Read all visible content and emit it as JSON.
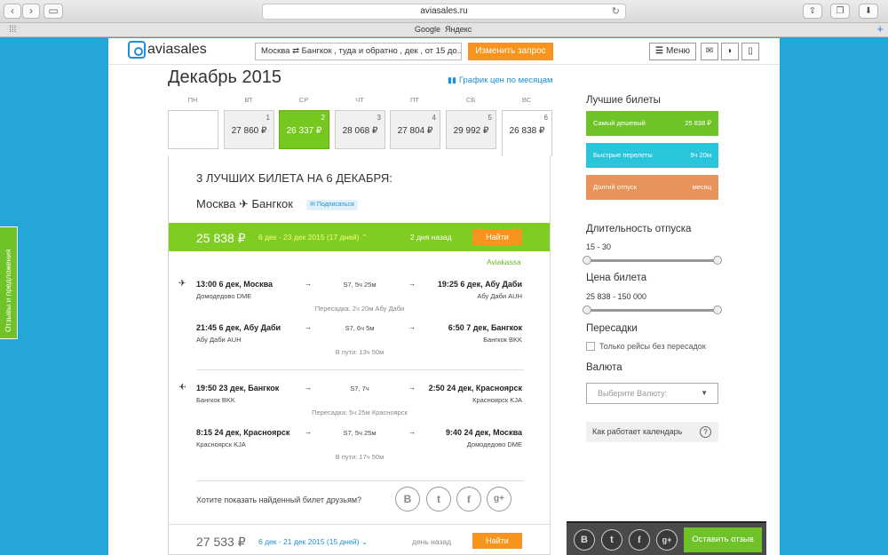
{
  "browser": {
    "url": "aviasales.ru",
    "reload_glyph": "↻",
    "back_glyph": "‹",
    "forward_glyph": "›",
    "bookmarks": [
      "Google",
      "Яндекс"
    ]
  },
  "header": {
    "logo": "aviasales",
    "search_summary": "Москва ⇄ Бангкок , туда и обратно , дек , от 15 до...",
    "change_label": "Изменить запрос",
    "menu_label": "Меню"
  },
  "calendar": {
    "title": "Декабрь 2015",
    "price_chart_link": "График цен по месяцам",
    "weekdays": [
      "ПН",
      "ВТ",
      "СР",
      "ЧТ",
      "ПТ",
      "СБ",
      "ВС"
    ],
    "days": [
      {
        "num": "",
        "price": ""
      },
      {
        "num": "1",
        "price": "27 860 ₽"
      },
      {
        "num": "2",
        "price": "26 337 ₽"
      },
      {
        "num": "3",
        "price": "28 068 ₽"
      },
      {
        "num": "4",
        "price": "27 804 ₽"
      },
      {
        "num": "5",
        "price": "29 992 ₽"
      },
      {
        "num": "6",
        "price": "26 838 ₽"
      }
    ]
  },
  "results": {
    "heading": "3 ЛУЧШИХ БИЛЕТА НА 6 ДЕКАБРЯ:",
    "route": "Москва ✈ Бангкок",
    "subscribe": "Подписаться",
    "offer1": {
      "price": "25 838 ₽",
      "dates": "6 дек - 23 дек 2015 (17 дней)",
      "ago": "2 дня назад",
      "buy": "Найти",
      "agency": "Aviakassa",
      "legs": [
        {
          "dep": "13:00 6 дек, Москва",
          "dep_ap": "Домодедово DME",
          "dur": "S7, 5ч 25м",
          "arr": "19:25 6 дек, Абу Даби",
          "arr_ap": "Абу Даби AUH"
        },
        {
          "dep": "21:45 6 дек, Абу Даби",
          "dep_ap": "Абу Даби AUH",
          "dur": "S7, 6ч 5м",
          "arr": "6:50 7 дек, Бангкок",
          "arr_ap": "Бангкок BKK"
        },
        {
          "dep": "19:50 23 дек, Бангкок",
          "dep_ap": "Бангкок BKK",
          "dur": "S7, 7ч",
          "arr": "2:50 24 дек, Красноярск",
          "arr_ap": "Красноярск KJA"
        },
        {
          "dep": "8:15 24 дек, Красноярск",
          "dep_ap": "Красноярск KJA",
          "dur": "S7, 5ч 25м",
          "arr": "9:40 24 дек, Москва",
          "arr_ap": "Домодедово DME"
        }
      ],
      "notes": [
        "Пересадка: 2ч 20м Абу Даби",
        "В пути: 13ч 50м",
        "Пересадка: 5ч 25м Красноярск",
        "В пути: 17ч 50м"
      ]
    },
    "share_text": "Хотите показать найденный билет друзьям?",
    "offer2": {
      "price": "27 533 ₽",
      "dates": "6 дек - 21 дек 2015 (15 дней)",
      "ago": "день назад",
      "buy": "Найти"
    }
  },
  "sidebar": {
    "best_title": "Лучшие билеты",
    "best": [
      {
        "label": "Самый дешевый",
        "value": "25 838 ₽",
        "color": "#6fc329"
      },
      {
        "label": "Быстрые перелеты",
        "value": "9ч 20м",
        "color": "#29c6db"
      },
      {
        "label": "Долгий отпуск",
        "value": "месяц",
        "color": "#e8935a"
      }
    ],
    "duration_title": "Длительность отпуска",
    "duration_range": "15 - 30",
    "price_title": "Цена билета",
    "price_range": "25 838 - 150 000",
    "transfers_title": "Пересадки",
    "transfers_checkbox": "Только рейсы без пересадок",
    "currency_title": "Валюта",
    "currency_placeholder": "Выберите Валюту:",
    "how_label": "Как работает календарь",
    "how_icon": "?"
  },
  "feedback": {
    "button": "Оставить отзыв",
    "side_tab": "Отзывы и предложения"
  },
  "social": [
    "В",
    "t",
    "f",
    "g+"
  ]
}
